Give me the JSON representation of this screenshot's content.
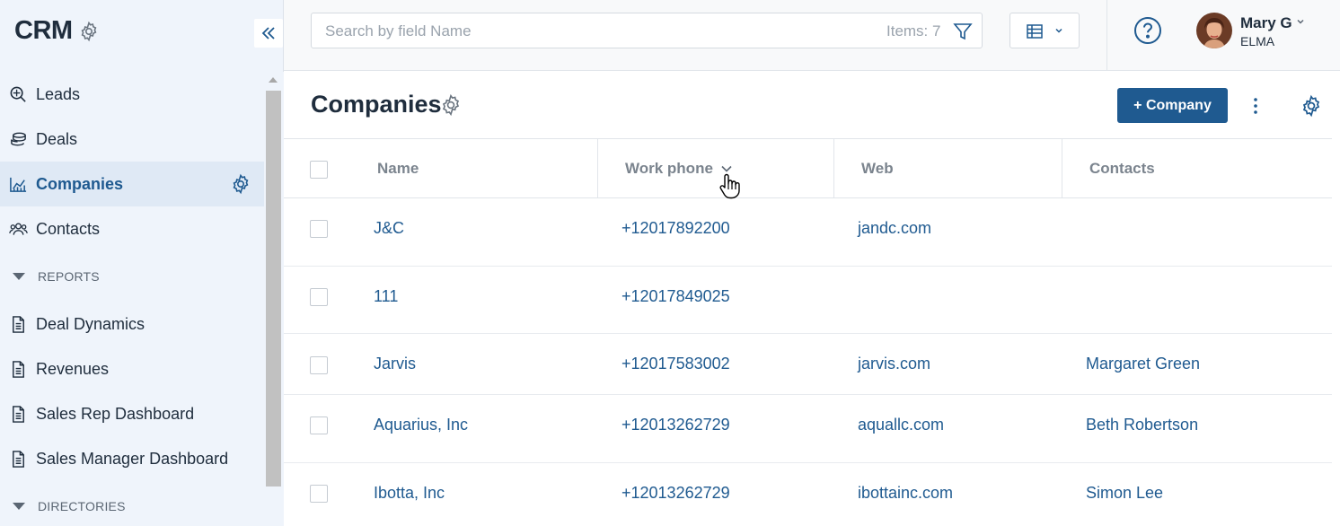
{
  "app": {
    "logo": "CRM"
  },
  "sidebar": {
    "items": [
      {
        "label": "Leads",
        "icon": "leads-search-icon"
      },
      {
        "label": "Deals",
        "icon": "deals-coins-icon"
      },
      {
        "label": "Companies",
        "icon": "companies-chart-icon",
        "active": true
      },
      {
        "label": "Contacts",
        "icon": "contacts-people-icon"
      }
    ],
    "reports_label": "REPORTS",
    "reports": [
      {
        "label": "Deal Dynamics",
        "icon": "document-icon"
      },
      {
        "label": "Revenues",
        "icon": "document-icon"
      },
      {
        "label": "Sales Rep Dashboard",
        "icon": "document-icon"
      },
      {
        "label": "Sales Manager Dashboard",
        "icon": "document-icon"
      }
    ],
    "directories_label": "DIRECTORIES"
  },
  "topbar": {
    "search_placeholder": "Search by field Name",
    "items_count": "Items: 7",
    "user_name": "Mary G",
    "user_org": "ELMA"
  },
  "page": {
    "title": "Companies",
    "add_button": "+ Company"
  },
  "table": {
    "columns": [
      "Name",
      "Work phone",
      "Web",
      "Contacts"
    ],
    "rows": [
      {
        "name": "J&C",
        "phone": "+12017892200",
        "web": "jandc.com",
        "contact": ""
      },
      {
        "name": "111",
        "phone": "+12017849025",
        "web": "",
        "contact": ""
      },
      {
        "name": "Jarvis",
        "phone": "+12017583002",
        "web": "jarvis.com",
        "contact": "Margaret Green"
      },
      {
        "name": "Aquarius, Inc",
        "phone": "+12013262729",
        "web": "aquallc.com",
        "contact": "Beth Robertson"
      },
      {
        "name": "Ibotta, Inc",
        "phone": "+12013262729",
        "web": "ibottainc.com",
        "contact": "Simon Lee"
      }
    ]
  },
  "colors": {
    "accent": "#1f5a90",
    "sidebar_bg": "#eff4fb",
    "active_bg": "#dfe9f5"
  }
}
